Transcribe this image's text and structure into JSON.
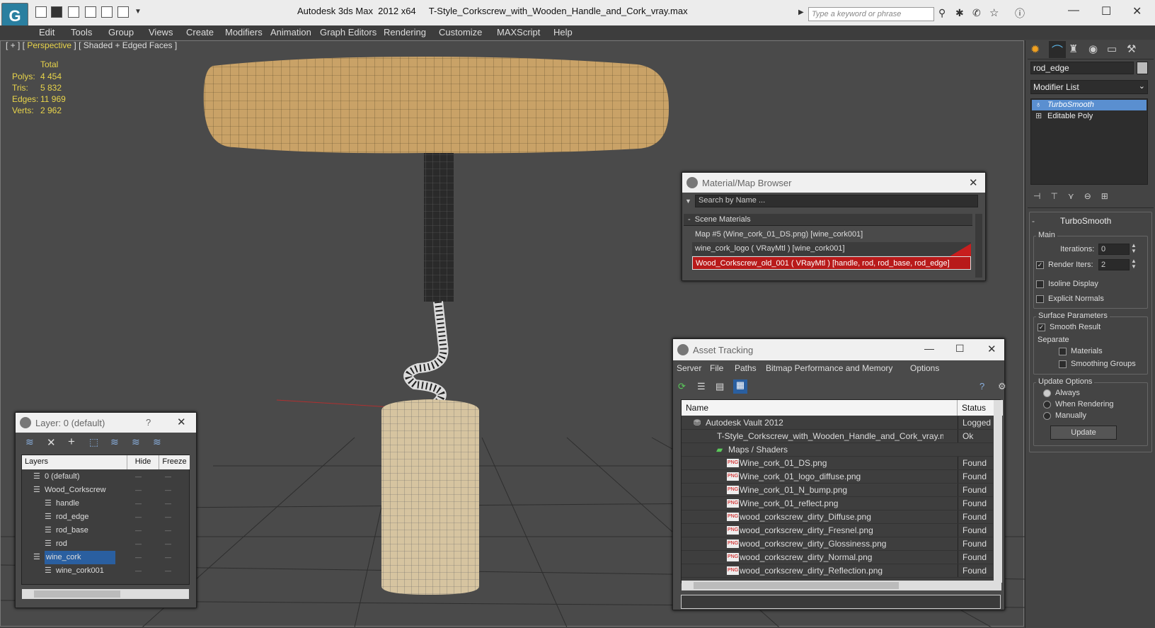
{
  "app": {
    "title": "Autodesk 3ds Max  2012 x64",
    "file": "T-Style_Corkscrew_with_Wooden_Handle_and_Cork_vray.max",
    "logo": "G",
    "search_placeholder": "Type a keyword or phrase"
  },
  "menu": [
    "Edit",
    "Tools",
    "Group",
    "Views",
    "Create",
    "Modifiers",
    "Animation",
    "Graph Editors",
    "Rendering",
    "Customize",
    "MAXScript",
    "Help"
  ],
  "viewport": {
    "label_open": "[ + ] [",
    "label_view": "Perspective",
    "label_close": "] [ Shaded + Edged Faces ]",
    "stats": {
      "header": "Total",
      "labels": [
        "Polys:",
        "Tris:",
        "Edges:",
        "Verts:"
      ],
      "values": [
        "4 454",
        "5 832",
        "11 969",
        "2 962"
      ]
    }
  },
  "command_panel": {
    "object_name": "rod_edge",
    "modifier_list": "Modifier List",
    "stack": [
      "TurboSmooth",
      "Editable Poly"
    ],
    "rollout_title": "TurboSmooth",
    "main": "Main",
    "iterations_label": "Iterations:",
    "iterations": "0",
    "render_iters_label": "Render Iters:",
    "render_iters": "2",
    "isoline": "Isoline Display",
    "explicit": "Explicit Normals",
    "surface": "Surface Parameters",
    "smooth": "Smooth Result",
    "separate": "Separate",
    "materials": "Materials",
    "smoothing": "Smoothing Groups",
    "update_options": "Update Options",
    "always": "Always",
    "when_rendering": "When Rendering",
    "manually": "Manually",
    "update_button": "Update"
  },
  "material_browser": {
    "title": "Material/Map Browser",
    "search": "Search by Name ...",
    "section": "Scene Materials",
    "items": [
      "Map #5 (Wine_cork_01_DS.png)  [wine_cork001]",
      "wine_cork_logo  ( VRayMtl )  [wine_cork001]",
      "Wood_Corkscrew_old_001  ( VRayMtl )  [handle, rod, rod_base, rod_edge]"
    ]
  },
  "asset_tracking": {
    "title": "Asset Tracking",
    "menu": [
      "Server",
      "File",
      "Paths",
      "Bitmap Performance and Memory",
      "Options"
    ],
    "col_name": "Name",
    "col_status": "Status",
    "rows": [
      {
        "name": "Autodesk Vault 2012",
        "status": "Logged O",
        "indent": 1
      },
      {
        "name": "T-Style_Corkscrew_with_Wooden_Handle_and_Cork_vray.max",
        "status": "Ok",
        "indent": 2
      },
      {
        "name": "Maps / Shaders",
        "status": "",
        "indent": 3
      },
      {
        "name": "Wine_cork_01_DS.png",
        "status": "Found",
        "indent": 4
      },
      {
        "name": "Wine_cork_01_logo_diffuse.png",
        "status": "Found",
        "indent": 4
      },
      {
        "name": "Wine_cork_01_N_bump.png",
        "status": "Found",
        "indent": 4
      },
      {
        "name": "Wine_cork_01_reflect.png",
        "status": "Found",
        "indent": 4
      },
      {
        "name": "wood_corkscrew_dirty_Diffuse.png",
        "status": "Found",
        "indent": 4
      },
      {
        "name": "wood_corkscrew_dirty_Fresnel.png",
        "status": "Found",
        "indent": 4
      },
      {
        "name": "wood_corkscrew_dirty_Glossiness.png",
        "status": "Found",
        "indent": 4
      },
      {
        "name": "wood_corkscrew_dirty_Normal.png",
        "status": "Found",
        "indent": 4
      },
      {
        "name": "wood_corkscrew_dirty_Reflection.png",
        "status": "Found",
        "indent": 4
      }
    ],
    "png_badge": "PNG"
  },
  "layer_window": {
    "title": "Layer: 0 (default)",
    "help": "?",
    "col_layers": "Layers",
    "col_hide": "Hide",
    "col_freeze": "Freeze",
    "rows": [
      {
        "name": "0 (default)",
        "indent": 1
      },
      {
        "name": "Wood_Corkscrew",
        "indent": 1
      },
      {
        "name": "handle",
        "indent": 2
      },
      {
        "name": "rod_edge",
        "indent": 2
      },
      {
        "name": "rod_base",
        "indent": 2
      },
      {
        "name": "rod",
        "indent": 2
      },
      {
        "name": "wine_cork",
        "indent": 1
      },
      {
        "name": "wine_cork001",
        "indent": 2
      }
    ]
  }
}
